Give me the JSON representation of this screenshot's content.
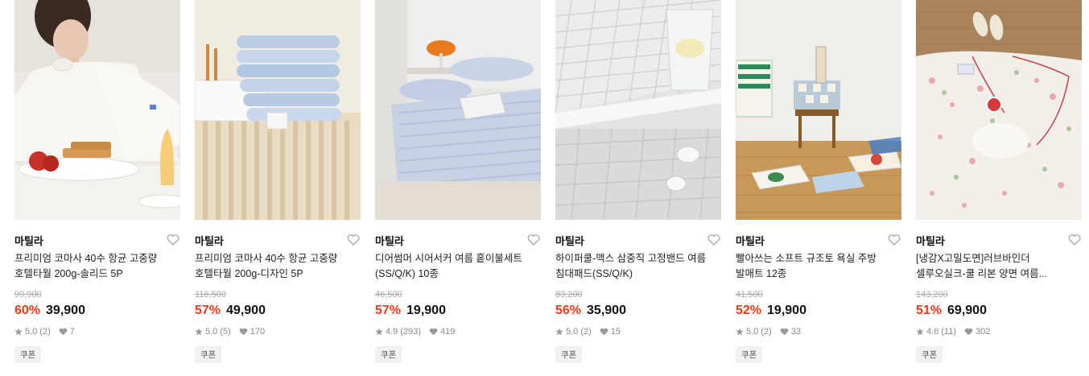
{
  "products": [
    {
      "brand": "마틸라",
      "title": "프리미엄 코마사 40수 항균 고중량 호텔타월 200g-솔리드 5P",
      "original_price": "99,900",
      "discount": "60%",
      "price": "39,900",
      "rating": "5.0",
      "review_count": "(2)",
      "likes": "7",
      "badge": "쿠폰",
      "image_icon": "towel-model-photo"
    },
    {
      "brand": "마틸라",
      "title": "프리미엄 코마사 40수 항균 고중량 호텔타월 200g-디자인 5P",
      "original_price": "116,500",
      "discount": "57%",
      "price": "49,900",
      "rating": "5.0",
      "review_count": "(5)",
      "likes": "170",
      "badge": "쿠폰",
      "image_icon": "towel-stack-photo"
    },
    {
      "brand": "마틸라",
      "title": "디어썸머 시어서커 여름 홑이불세트 (SS/Q/K) 10종",
      "original_price": "46,500",
      "discount": "57%",
      "price": "19,900",
      "rating": "4.9",
      "review_count": "(293)",
      "likes": "419",
      "badge": "쿠폰",
      "image_icon": "bedding-photo"
    },
    {
      "brand": "마틸라",
      "title": "하이퍼쿨-맥스 삼중직 고정밴드 여름 침대패드(SS/Q/K)",
      "original_price": "83,200",
      "discount": "56%",
      "price": "35,900",
      "rating": "5.0",
      "review_count": "(2)",
      "likes": "15",
      "badge": "쿠폰",
      "image_icon": "cooling-pad-photo"
    },
    {
      "brand": "마틸라",
      "title": "빨아쓰는 소프트 규조토 욕실 주방 발매트 12종",
      "original_price": "41,500",
      "discount": "52%",
      "price": "19,900",
      "rating": "5.0",
      "review_count": "(2)",
      "likes": "33",
      "badge": "쿠폰",
      "image_icon": "bath-mat-photo"
    },
    {
      "brand": "마틸라",
      "title": "[냉감X고밀도면]러브바인더 셀루오실크-쿨 리본 양면 여름...",
      "original_price": "143,200",
      "discount": "51%",
      "price": "69,900",
      "rating": "4.6",
      "review_count": "(11)",
      "likes": "302",
      "badge": "쿠폰",
      "image_icon": "floral-blanket-photo"
    }
  ]
}
